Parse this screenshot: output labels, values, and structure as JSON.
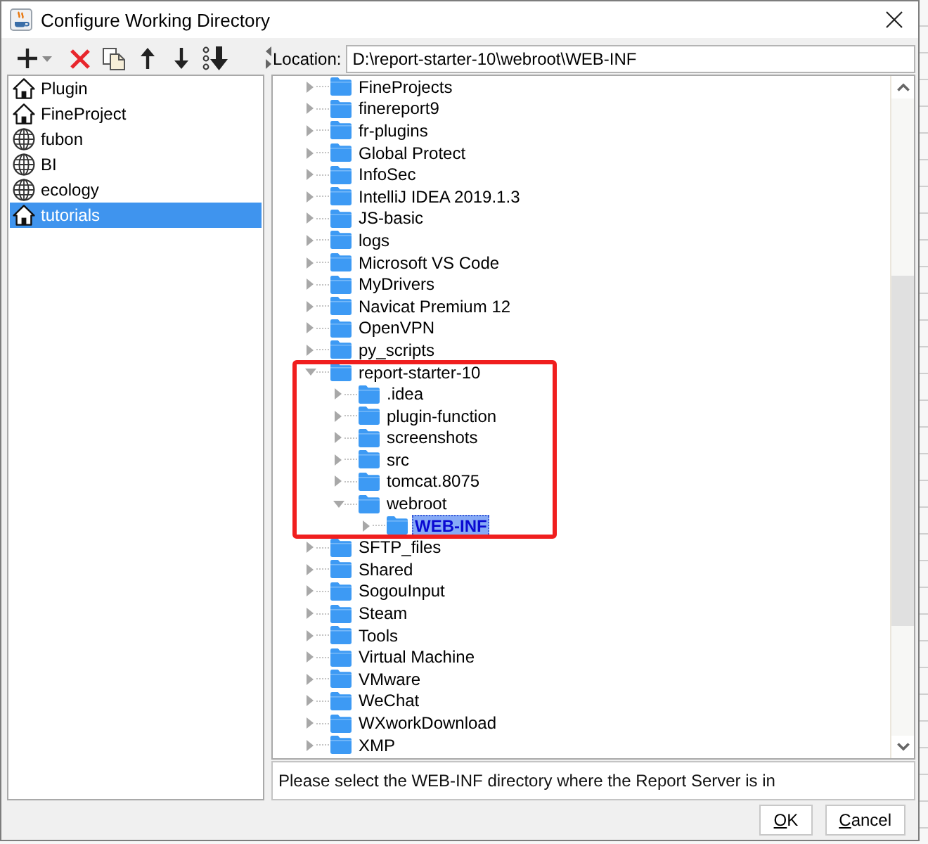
{
  "window": {
    "title": "Configure Working Directory"
  },
  "locations": [
    {
      "label": "Plugin",
      "kind": "local",
      "selected": false
    },
    {
      "label": "FineProject",
      "kind": "local",
      "selected": false
    },
    {
      "label": "fubon",
      "kind": "remote",
      "selected": false
    },
    {
      "label": "BI",
      "kind": "remote",
      "selected": false
    },
    {
      "label": "ecology",
      "kind": "remote",
      "selected": false
    },
    {
      "label": "tutorials",
      "kind": "local",
      "selected": true
    }
  ],
  "location_field": {
    "label": "Location:",
    "value": "D:\\report-starter-10\\webroot\\WEB-INF"
  },
  "tree": [
    {
      "label": "FineProjects",
      "expanded": false,
      "selected": false,
      "highlighted": false
    },
    {
      "label": "finereport9",
      "expanded": false,
      "selected": false,
      "highlighted": false
    },
    {
      "label": "fr-plugins",
      "expanded": false,
      "selected": false,
      "highlighted": false
    },
    {
      "label": "Global Protect",
      "expanded": false,
      "selected": false,
      "highlighted": false
    },
    {
      "label": "InfoSec",
      "expanded": false,
      "selected": false,
      "highlighted": false
    },
    {
      "label": "IntelliJ IDEA 2019.1.3",
      "expanded": false,
      "selected": false,
      "highlighted": false
    },
    {
      "label": "JS-basic",
      "expanded": false,
      "selected": false,
      "highlighted": false
    },
    {
      "label": "logs",
      "expanded": false,
      "selected": false,
      "highlighted": false
    },
    {
      "label": "Microsoft VS Code",
      "expanded": false,
      "selected": false,
      "highlighted": false
    },
    {
      "label": "MyDrivers",
      "expanded": false,
      "selected": false,
      "highlighted": false
    },
    {
      "label": "Navicat Premium 12",
      "expanded": false,
      "selected": false,
      "highlighted": false
    },
    {
      "label": "OpenVPN",
      "expanded": false,
      "selected": false,
      "highlighted": false
    },
    {
      "label": "py_scripts",
      "expanded": false,
      "selected": false,
      "highlighted": false
    },
    {
      "label": "report-starter-10",
      "expanded": true,
      "selected": false,
      "highlighted": true,
      "children": [
        {
          "label": ".idea",
          "expanded": false,
          "selected": false,
          "highlighted": false
        },
        {
          "label": "plugin-function",
          "expanded": false,
          "selected": false,
          "highlighted": false
        },
        {
          "label": "screenshots",
          "expanded": false,
          "selected": false,
          "highlighted": false
        },
        {
          "label": "src",
          "expanded": false,
          "selected": false,
          "highlighted": false
        },
        {
          "label": "tomcat.8075",
          "expanded": false,
          "selected": false,
          "highlighted": false
        },
        {
          "label": "webroot",
          "expanded": true,
          "selected": false,
          "highlighted": false,
          "children": [
            {
              "label": "WEB-INF",
              "expanded": false,
              "selected": true,
              "highlighted": false
            }
          ]
        }
      ]
    },
    {
      "label": "SFTP_files",
      "expanded": false,
      "selected": false,
      "highlighted": false
    },
    {
      "label": "Shared",
      "expanded": false,
      "selected": false,
      "highlighted": false
    },
    {
      "label": "SogouInput",
      "expanded": false,
      "selected": false,
      "highlighted": false
    },
    {
      "label": "Steam",
      "expanded": false,
      "selected": false,
      "highlighted": false
    },
    {
      "label": "Tools",
      "expanded": false,
      "selected": false,
      "highlighted": false
    },
    {
      "label": "Virtual Machine",
      "expanded": false,
      "selected": false,
      "highlighted": false
    },
    {
      "label": "VMware",
      "expanded": false,
      "selected": false,
      "highlighted": false
    },
    {
      "label": "WeChat",
      "expanded": false,
      "selected": false,
      "highlighted": false
    },
    {
      "label": "WXworkDownload",
      "expanded": false,
      "selected": false,
      "highlighted": false
    },
    {
      "label": "XMP",
      "expanded": false,
      "selected": false,
      "highlighted": false
    }
  ],
  "status_message": "Please select the WEB-INF directory where the Report Server is in",
  "buttons": [
    "OK",
    "Cancel"
  ]
}
